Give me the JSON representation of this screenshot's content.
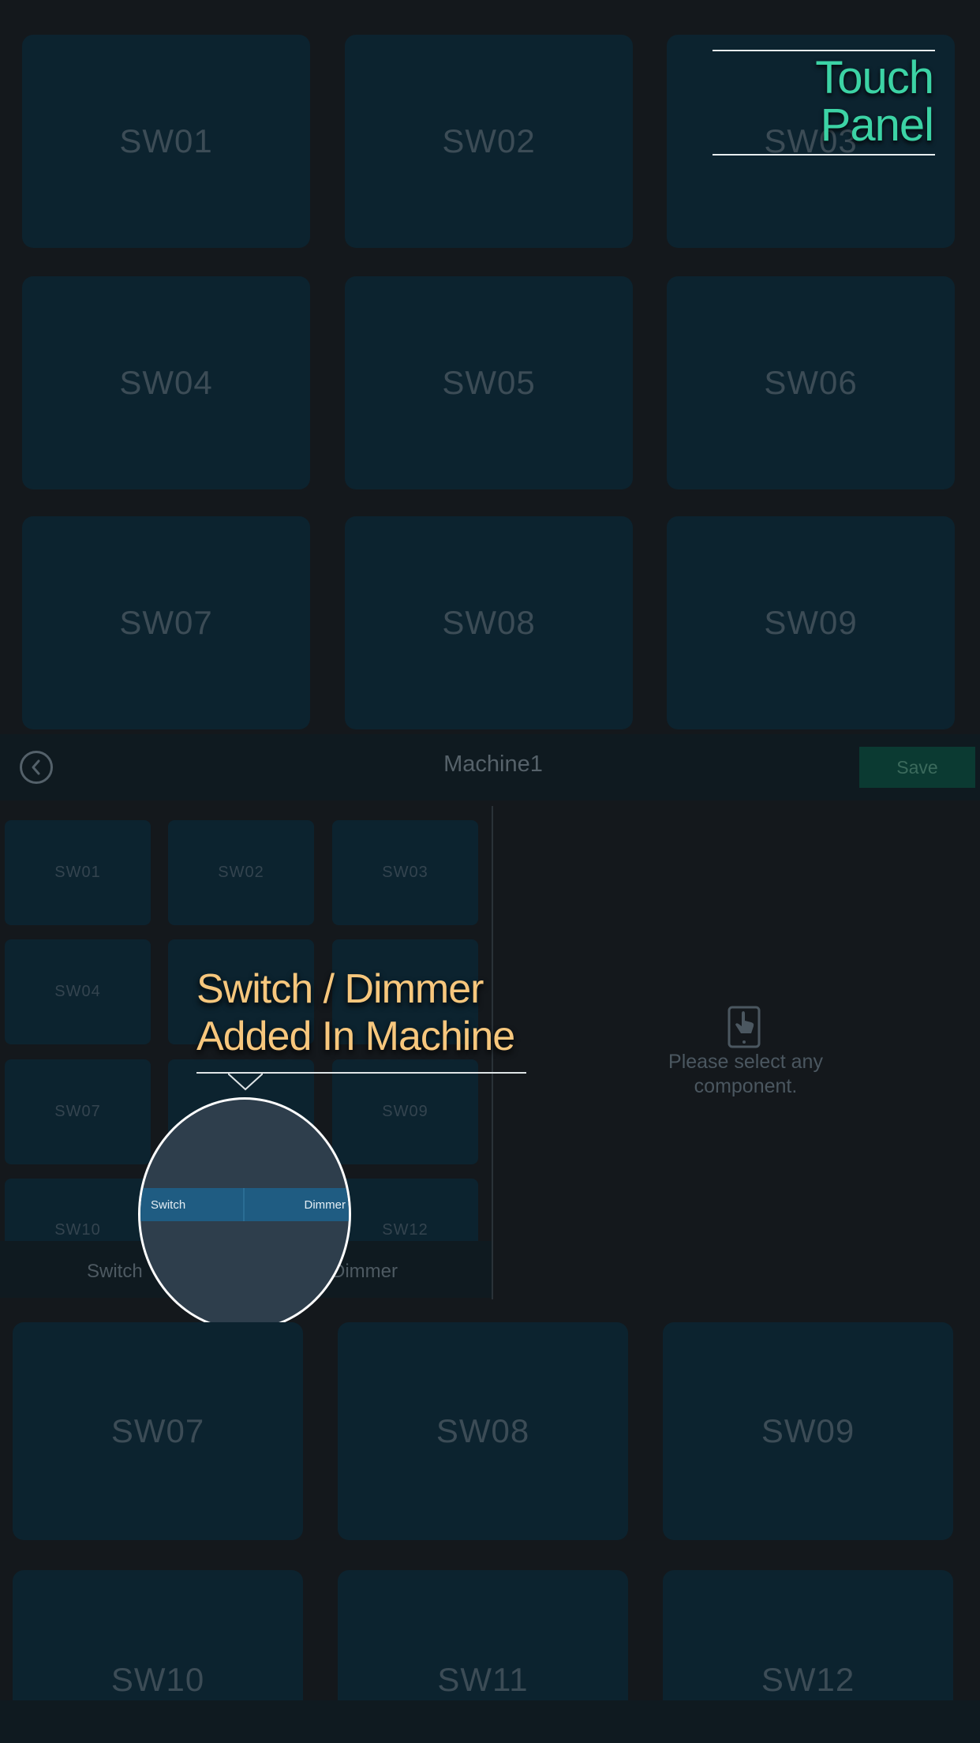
{
  "watermark_title": "Touch Panel",
  "top_grid": [
    "SW01",
    "SW02",
    "SW03",
    "SW04",
    "SW05",
    "SW06",
    "SW07",
    "SW08",
    "SW09"
  ],
  "header": {
    "title": "Machine1",
    "save_label": "Save"
  },
  "mini_grid": [
    "SW01",
    "SW02",
    "SW03",
    "SW04",
    "SW07",
    "SW09",
    "SW10",
    "SW12"
  ],
  "tabs": {
    "switch_label": "Switch",
    "dimmer_label": "Dimmer"
  },
  "empty_state": {
    "message": "Please select any component.",
    "icon": "touch-tablet-icon"
  },
  "callout": {
    "line1": "Switch / Dimmer",
    "line2": "Added In Machine"
  },
  "magnifier": {
    "switch_label": "Switch",
    "dimmer_label": "Dimmer"
  },
  "bottom_grid": [
    "SW07",
    "SW08",
    "SW09",
    "SW10",
    "SW11",
    "SW12"
  ],
  "colors": {
    "accent": "#3cd3a5",
    "callout": "#f7c77d",
    "tile": "#0c232f",
    "save_bg": "#0b3a32"
  }
}
